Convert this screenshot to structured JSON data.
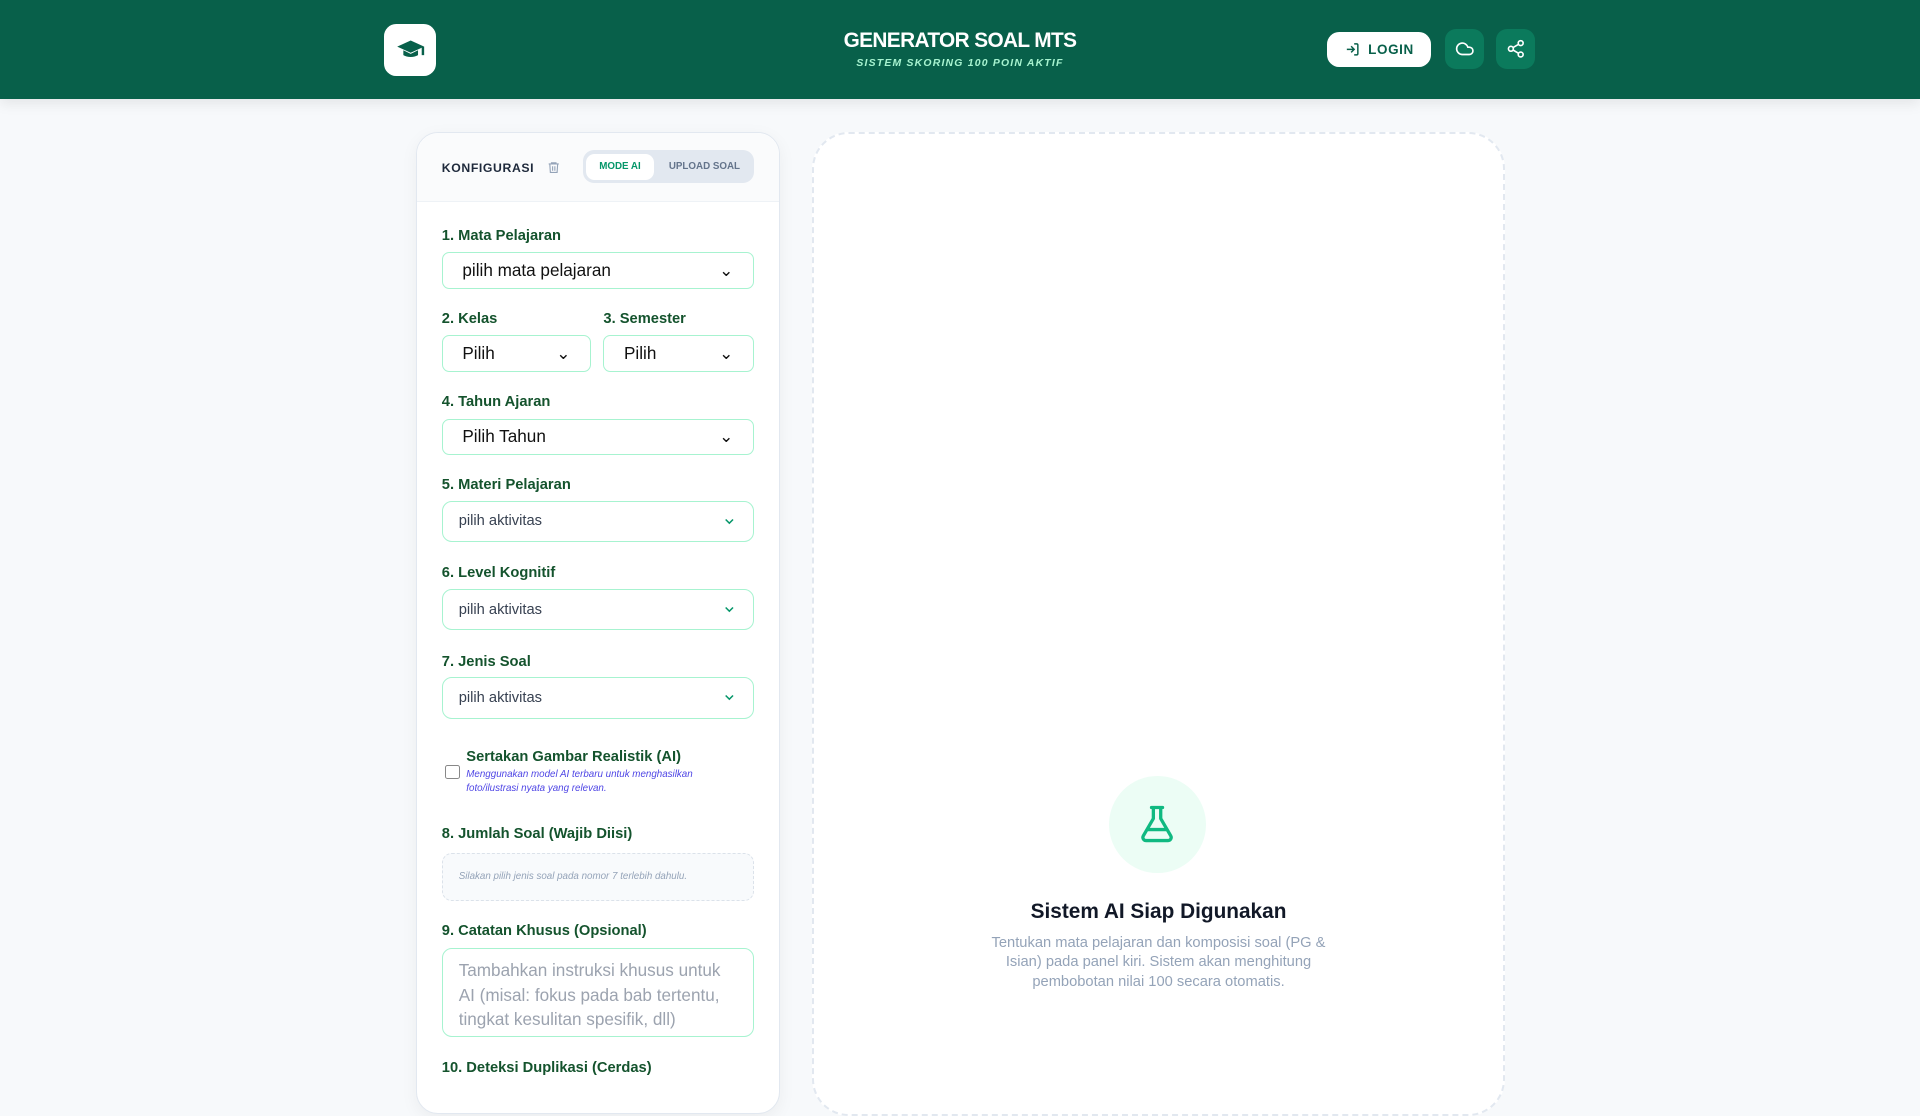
{
  "header": {
    "title": "GENERATOR SOAL MTS",
    "subtitle": "SISTEM SKORING 100 POIN AKTIF",
    "login": "LOGIN"
  },
  "panel": {
    "title": "KONFIGURASI",
    "mode_ai": "MODE AI",
    "upload": "UPLOAD SOAL",
    "f1_label": "1. Mata Pelajaran",
    "f1_value": "pilih mata pelajaran",
    "f2_label": "2. Kelas",
    "f2_value": "Pilih",
    "f3_label": "3. Semester",
    "f3_value": "Pilih",
    "f4_label": "4. Tahun Ajaran",
    "f4_value": "Pilih Tahun",
    "f5_label": "5. Materi Pelajaran",
    "f5_value": "pilih aktivitas",
    "f6_label": "6. Level Kognitif",
    "f6_value": "pilih aktivitas",
    "f7_label": "7. Jenis Soal",
    "f7_value": "pilih aktivitas",
    "img_label": "Sertakan Gambar Realistik (AI)",
    "img_desc": "Menggunakan model AI terbaru untuk menghasilkan foto/ilustrasi nyata yang relevan.",
    "f8_label": "8. Jumlah Soal (Wajib Diisi)",
    "f8_hint": "Silakan pilih jenis soal pada nomor 7 terlebih dahulu.",
    "f9_label": "9. Catatan Khusus (Opsional)",
    "f9_placeholder": "Tambahkan instruksi khusus untuk AI (misal: fokus pada bab tertentu, tingkat kesulitan spesifik, dll)",
    "f10_label": "10. Deteksi Duplikasi (Cerdas)"
  },
  "empty": {
    "title": "Sistem AI Siap Digunakan",
    "desc": "Tentukan mata pelajaran dan komposisi soal (PG & Isian) pada panel kiri. Sistem akan menghitung pembobotan nilai 100 secara otomatis."
  }
}
